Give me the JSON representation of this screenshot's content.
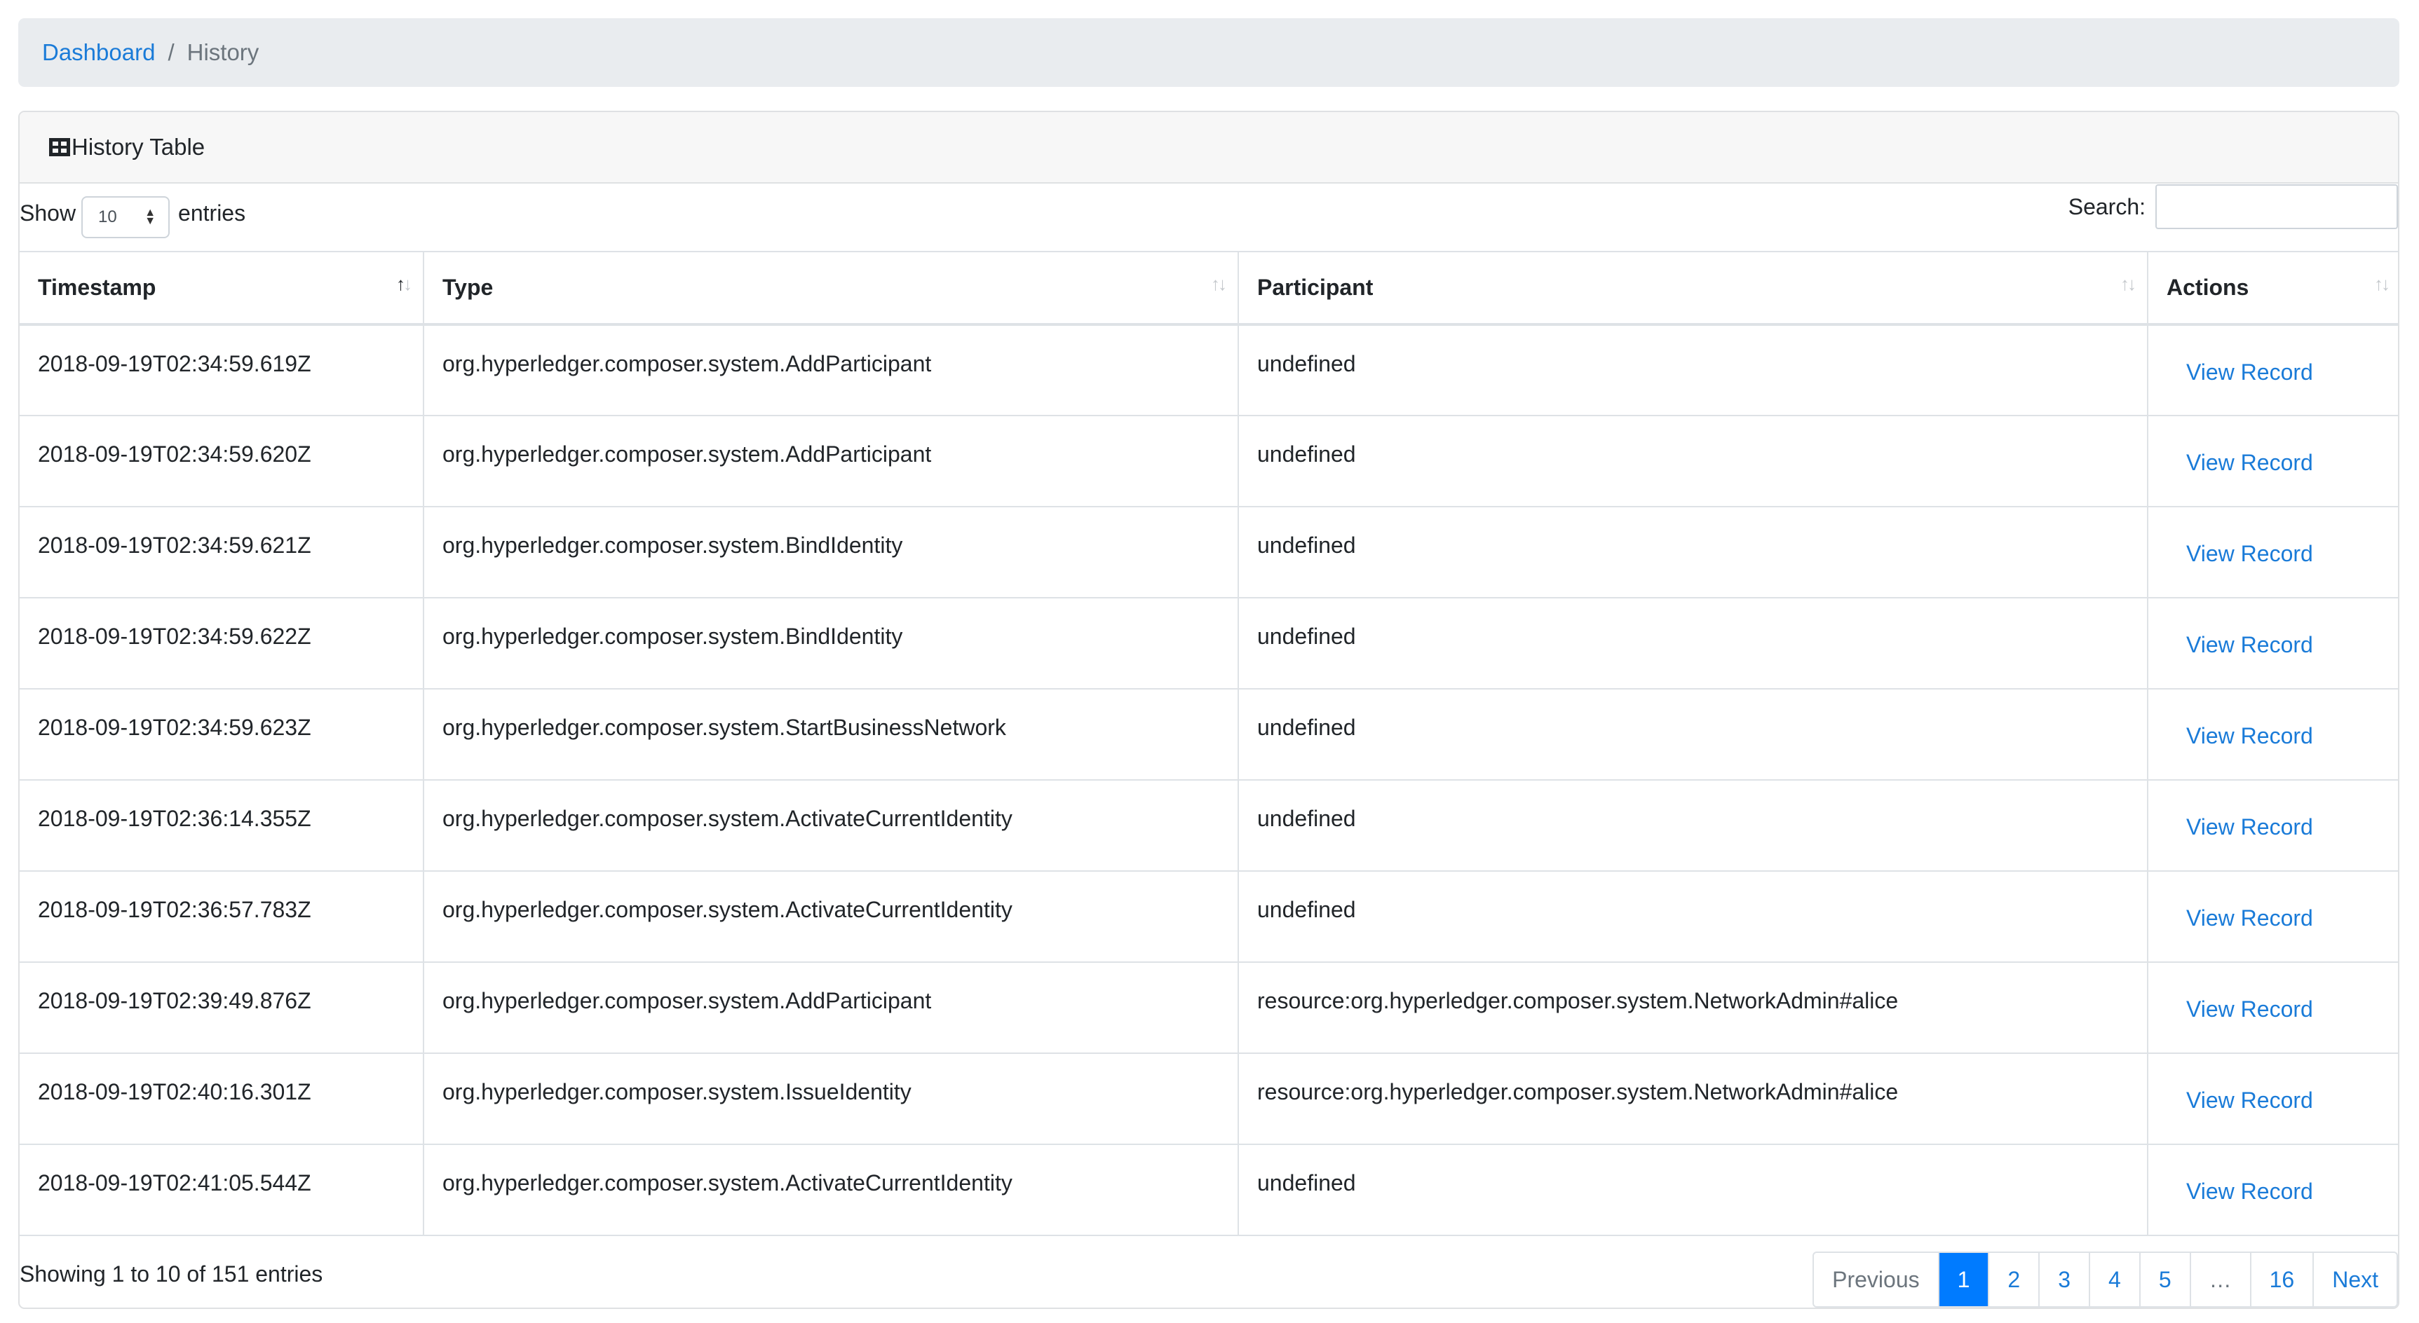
{
  "breadcrumb": {
    "home": "Dashboard",
    "separator": "/",
    "current": "History"
  },
  "card": {
    "title": "History Table",
    "title_icon": "table-icon"
  },
  "length": {
    "prefix": "Show",
    "value": "10",
    "suffix": "entries"
  },
  "search": {
    "label": "Search:",
    "value": ""
  },
  "table": {
    "columns": [
      "Timestamp",
      "Type",
      "Participant",
      "Actions"
    ],
    "sorted_column": "Timestamp",
    "action_label": "View Record",
    "rows": [
      {
        "timestamp": "2018-09-19T02:34:59.619Z",
        "type": "org.hyperledger.composer.system.AddParticipant",
        "participant": "undefined"
      },
      {
        "timestamp": "2018-09-19T02:34:59.620Z",
        "type": "org.hyperledger.composer.system.AddParticipant",
        "participant": "undefined"
      },
      {
        "timestamp": "2018-09-19T02:34:59.621Z",
        "type": "org.hyperledger.composer.system.BindIdentity",
        "participant": "undefined"
      },
      {
        "timestamp": "2018-09-19T02:34:59.622Z",
        "type": "org.hyperledger.composer.system.BindIdentity",
        "participant": "undefined"
      },
      {
        "timestamp": "2018-09-19T02:34:59.623Z",
        "type": "org.hyperledger.composer.system.StartBusinessNetwork",
        "participant": "undefined"
      },
      {
        "timestamp": "2018-09-19T02:36:14.355Z",
        "type": "org.hyperledger.composer.system.ActivateCurrentIdentity",
        "participant": "undefined"
      },
      {
        "timestamp": "2018-09-19T02:36:57.783Z",
        "type": "org.hyperledger.composer.system.ActivateCurrentIdentity",
        "participant": "undefined"
      },
      {
        "timestamp": "2018-09-19T02:39:49.876Z",
        "type": "org.hyperledger.composer.system.AddParticipant",
        "participant": "resource:org.hyperledger.composer.system.NetworkAdmin#alice"
      },
      {
        "timestamp": "2018-09-19T02:40:16.301Z",
        "type": "org.hyperledger.composer.system.IssueIdentity",
        "participant": "resource:org.hyperledger.composer.system.NetworkAdmin#alice"
      },
      {
        "timestamp": "2018-09-19T02:41:05.544Z",
        "type": "org.hyperledger.composer.system.ActivateCurrentIdentity",
        "participant": "undefined"
      }
    ]
  },
  "info": "Showing 1 to 10 of 151 entries",
  "pagination": {
    "previous": "Previous",
    "pages": [
      "1",
      "2",
      "3",
      "4",
      "5",
      "…",
      "16"
    ],
    "active_page": "1",
    "next": "Next"
  },
  "colors": {
    "link": "#1a7bd8",
    "active_page": "#007bff",
    "breadcrumb_bg": "#e9ecef"
  }
}
